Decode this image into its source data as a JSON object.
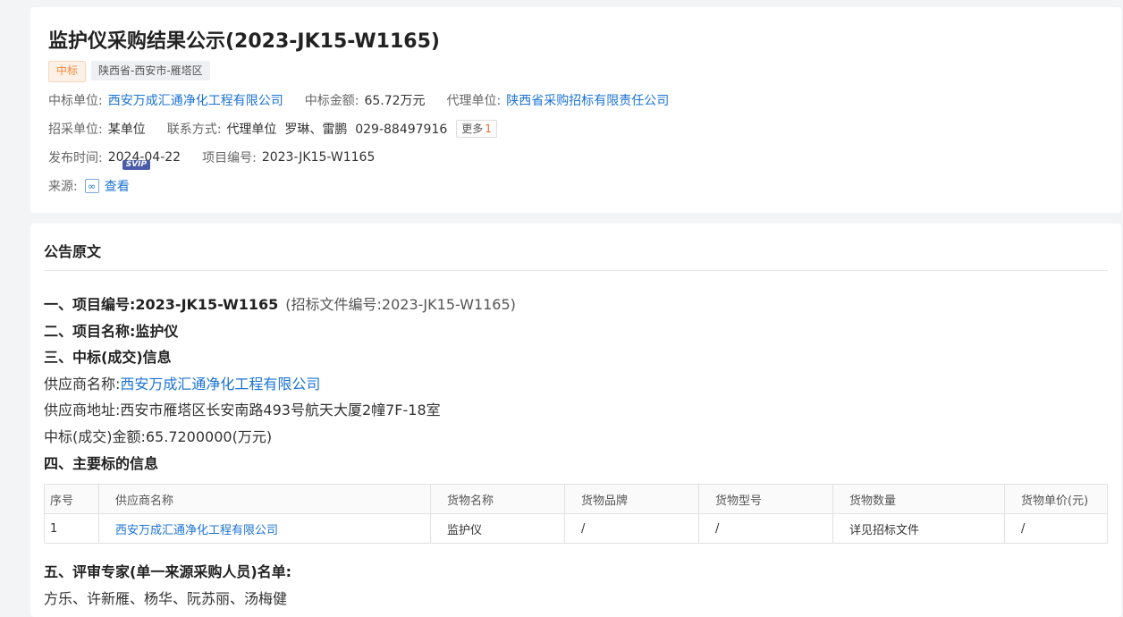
{
  "header": {
    "title": "监护仪采购结果公示(2023-JK15-W1165)",
    "tag_status": "中标",
    "tag_region": "陕西省-西安市-雁塔区",
    "winner_label": "中标单位:",
    "winner_value": "西安万成汇通净化工程有限公司",
    "amount_label": "中标金额:",
    "amount_value": "65.72万元",
    "agent_label": "代理单位:",
    "agent_value": "陕西省采购招标有限责任公司",
    "buyer_label": "招采单位:",
    "buyer_value": "某单位",
    "contact_label": "联系方式:",
    "contact_value": "代理单位  罗琳、雷鹏  029-88497916",
    "more_label": "更多",
    "more_count": "1",
    "date_label": "发布时间:",
    "date_value": "2024-04-22",
    "project_no_label": "项目编号:",
    "project_no_value": "2023-JK15-W1165",
    "source_label": "来源:",
    "source_link": "查看",
    "svip_badge": "SVIP"
  },
  "notice": {
    "section_title": "公告原文",
    "line1_bold": "一、项目编号:2023-JK15-W1165",
    "line1_sub": "(招标文件编号:2023-JK15-W1165)",
    "line2": "二、项目名称:监护仪",
    "line3": "三、中标(成交)信息",
    "supplier_name_label": "供应商名称:",
    "supplier_name_value": "西安万成汇通净化工程有限公司",
    "supplier_addr_label": "供应商地址:",
    "supplier_addr_value": "西安市雁塔区长安南路493号航天大厦2幢7F-18室",
    "amount_line": "中标(成交)金额:65.7200000(万元)",
    "line4": "四、主要标的信息",
    "table": {
      "headers": [
        "序号",
        "供应商名称",
        "货物名称",
        "货物品牌",
        "货物型号",
        "货物数量",
        "货物单价(元)"
      ],
      "rows": [
        [
          "1",
          "西安万成汇通净化工程有限公司",
          "监护仪",
          "/",
          "/",
          "详见招标文件",
          "/"
        ]
      ]
    },
    "line5": "五、评审专家(单一来源采购人员)名单:",
    "experts": "方乐、许新雁、杨华、阮苏丽、汤梅健"
  }
}
